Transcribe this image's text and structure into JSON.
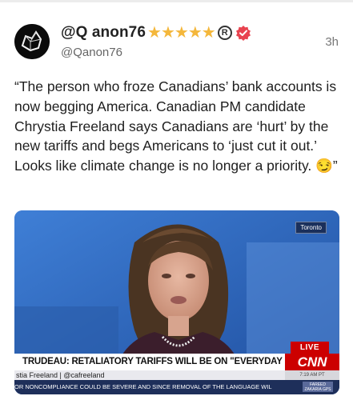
{
  "post": {
    "display_name": "@Q anon76",
    "handle": "@Qanon76",
    "timestamp": "3h",
    "badges": {
      "stars": [
        "★",
        "★",
        "★",
        "★",
        "★"
      ],
      "registered": "R",
      "verified_icon": "verified-check-icon",
      "star_color": "#f4b73b",
      "verified_color": "#e8434f"
    },
    "text": "“The person who froze Canadians’ bank accounts is now begging America. Canadian PM candidate Chrystia Freeland says Canadians are ‘hurt’ by the new tariffs and begs Americans to ‘just cut it out.’ Looks like climate change is no longer a priority. 😏”"
  },
  "media": {
    "location_tag": "Toronto",
    "live_label": "LIVE",
    "headline": "TRUDEAU: RETALIATORY TARIFFS WILL BE ON \"EVERYDAY ITEMS\"",
    "network": "CNN",
    "subline": "stia Freeland  |  @cafreeland",
    "time": "7:19 AM PT",
    "ticker": "OR NONCOMPLIANCE COULD BE SEVERE AND SINCE REMOVAL OF THE LANGUAGE WIL",
    "ticker_tag": "FAREED ZAKARIA GPS"
  }
}
